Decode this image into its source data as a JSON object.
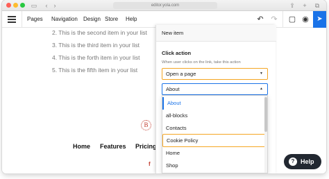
{
  "browser": {
    "url": "editor.yola.com"
  },
  "appbar": {
    "nav": [
      "Pages",
      "Navigation",
      "Design",
      "Store",
      "Help"
    ],
    "icons": [
      "undo-icon",
      "redo-icon",
      "save-icon",
      "preview-icon",
      "publish-icon"
    ]
  },
  "page": {
    "list_items": [
      "2. This is the second item in your list",
      "3. This is the third item in your list",
      "4. This is the forth item in your list",
      "5. This is the fifth item in your list"
    ],
    "logo_letter": "B",
    "footer_nav": [
      "Home",
      "Features",
      "Pricing"
    ]
  },
  "panel": {
    "title": "New item",
    "click_action_label": "Click action",
    "click_action_hint": "When user clicks on the link, take this action",
    "action_value": "Open a page",
    "page_value": "About",
    "page_options": [
      "About",
      "all-blocks",
      "Contacts",
      "Cookie Policy",
      "Home",
      "Shop"
    ],
    "selected_option": "About",
    "highlighted_option": "Cookie Policy"
  },
  "help_button": {
    "label": "Help"
  },
  "colors": {
    "accent_orange": "#f5a623",
    "blue": "#1a73e8",
    "help_bg": "#222831"
  }
}
